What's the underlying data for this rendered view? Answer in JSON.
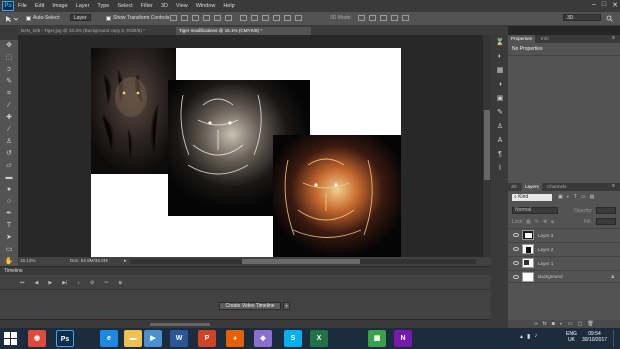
{
  "app": {
    "logo": "Ps"
  },
  "menu": [
    "File",
    "Edit",
    "Image",
    "Layer",
    "Type",
    "Select",
    "Filter",
    "3D",
    "View",
    "Window",
    "Help"
  ],
  "options_bar": {
    "auto_select_label": "Auto-Select:",
    "auto_select_value": "Layer",
    "show_transform_label": "Show Transform Controls",
    "mode_label": "3D Mode:",
    "workspace": "3D"
  },
  "tabs": [
    {
      "label": "B4N_108 - Tiger.jpg @ 33.3% (Background copy 2, RGB/8) *",
      "active": false
    },
    {
      "label": "Tiger modifications @ 15.1% (CMYK/8) *",
      "active": true
    }
  ],
  "status": {
    "zoom": "15.12%",
    "doc": "Doc: 54.9M/35.0M"
  },
  "timeline": {
    "title": "Timeline",
    "create_button": "Create Video Timeline"
  },
  "properties": {
    "tabs": [
      "Properties",
      "Info"
    ],
    "message": "No Properties"
  },
  "layers_panel": {
    "tabs": [
      "3D",
      "Layers",
      "Channels"
    ],
    "kind_filter": "Kind",
    "blend_mode": "Normal",
    "opacity_label": "Opacity:",
    "lock_label": "Lock:",
    "fill_label": "Fill:",
    "layers": [
      {
        "name": "Layer 3",
        "visible": true
      },
      {
        "name": "Layer 2",
        "visible": true
      },
      {
        "name": "Layer 1",
        "visible": true
      },
      {
        "name": "Background",
        "visible": true,
        "locked": true
      }
    ]
  },
  "taskbar": {
    "apps": [
      {
        "name": "chrome-icon",
        "color": "#e04a3a",
        "glyph": "◉"
      },
      {
        "name": "photoshop-icon",
        "color": "#0d2e4a",
        "glyph": "Ps"
      },
      {
        "name": "ie-icon",
        "color": "#1e88e5",
        "glyph": "e"
      },
      {
        "name": "explorer-icon",
        "color": "#f0c050",
        "glyph": "▬"
      },
      {
        "name": "media-icon",
        "color": "#4a90d0",
        "glyph": "▶"
      },
      {
        "name": "word-icon",
        "color": "#2b579a",
        "glyph": "W"
      },
      {
        "name": "powerpoint-icon",
        "color": "#d04423",
        "glyph": "P"
      },
      {
        "name": "firefox-icon",
        "color": "#e66000",
        "glyph": "◕"
      },
      {
        "name": "app-icon",
        "color": "#8a6ed0",
        "glyph": "◆"
      },
      {
        "name": "skype-icon",
        "color": "#00aff0",
        "glyph": "S"
      },
      {
        "name": "excel-icon",
        "color": "#217346",
        "glyph": "X"
      },
      {
        "name": "publisher-icon",
        "color": "#3aa04a",
        "glyph": "▦"
      },
      {
        "name": "onenote-icon",
        "color": "#7719aa",
        "glyph": "N"
      }
    ],
    "lang": "ENG",
    "region": "UK",
    "time": "09:54",
    "date": "30/10/2017"
  },
  "colors": {
    "accent": "#3fa4e8",
    "panel": "#535353",
    "taskbar": "#1c2b3d"
  }
}
